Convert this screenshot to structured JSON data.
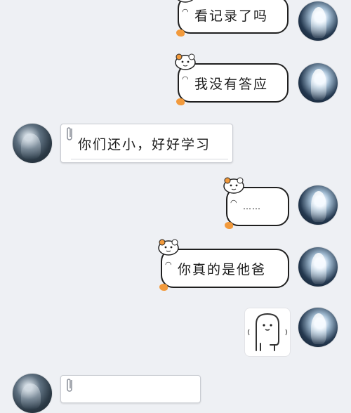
{
  "messages": [
    {
      "side": "right",
      "text": "看记录了吗"
    },
    {
      "side": "right",
      "text": "我没有答应"
    },
    {
      "side": "left",
      "text": "你们还小，好好学习"
    },
    {
      "side": "right",
      "text": "……"
    },
    {
      "side": "right",
      "text": "你真的是他爸"
    },
    {
      "side": "right",
      "sticker": "blob-character-sticker"
    },
    {
      "side": "left",
      "text": ""
    }
  ],
  "colors": {
    "background": "#eef0f4",
    "bubble_border": "#1f1f1f",
    "accent_orange": "#f29a3c"
  }
}
